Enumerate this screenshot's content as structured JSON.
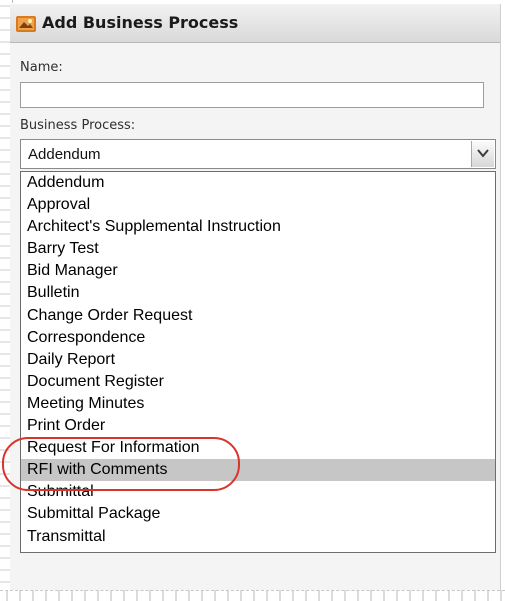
{
  "window": {
    "title": "Add Business Process",
    "icon": "app-icon"
  },
  "name_field": {
    "label": "Name:",
    "value": "",
    "placeholder": ""
  },
  "business_process": {
    "label": "Business Process:",
    "selected": "Addendum",
    "options": [
      "Addendum",
      "Approval",
      "Architect's Supplemental Instruction",
      "Barry Test",
      "Bid Manager",
      "Bulletin",
      "Change Order Request",
      "Correspondence",
      "Daily Report",
      "Document Register",
      "Meeting Minutes",
      "Print Order",
      "Request For Information",
      "RFI with Comments",
      "Submittal",
      "Submittal Package",
      "Transmittal"
    ],
    "highlighted": "RFI with Comments"
  },
  "colors": {
    "annotation": "#d9342b",
    "highlight": "#c6c6c6"
  }
}
